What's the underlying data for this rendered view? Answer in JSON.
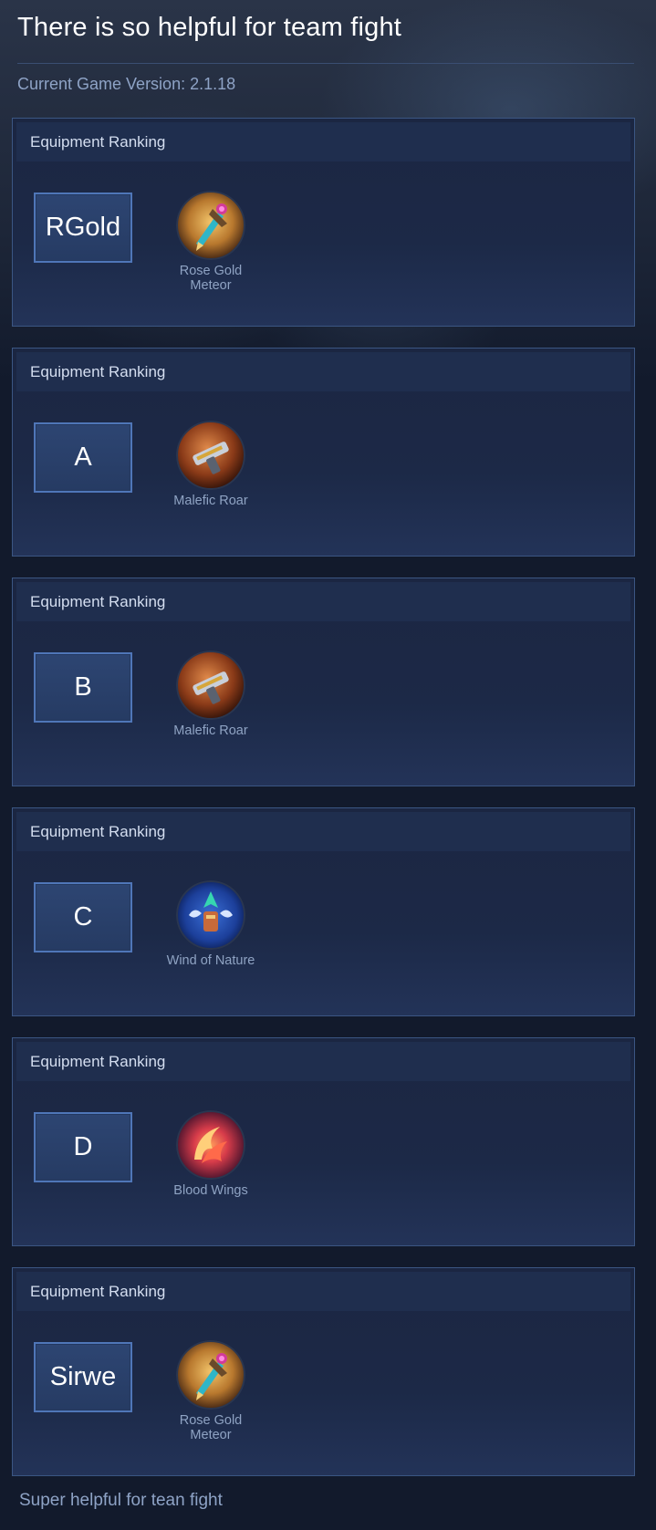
{
  "page": {
    "title": "There is so helpful for team fight",
    "version_text": "Current Game Version: 2.1.18",
    "footer_text": "Super helpful for tean fight"
  },
  "colors": {
    "background": "#121a2c",
    "card_border": "#3b5683",
    "badge_border": "#4f76b8",
    "muted_text": "#8ea3c6"
  },
  "rankings": [
    {
      "header": "Equipment Ranking",
      "tier": "RGold",
      "item": {
        "name": "Rose Gold Meteor",
        "icon": "rose-gold-meteor-icon"
      }
    },
    {
      "header": "Equipment Ranking",
      "tier": "A",
      "item": {
        "name": "Malefic Roar",
        "icon": "malefic-roar-icon"
      }
    },
    {
      "header": "Equipment Ranking",
      "tier": "B",
      "item": {
        "name": "Malefic Roar",
        "icon": "malefic-roar-icon"
      }
    },
    {
      "header": "Equipment Ranking",
      "tier": "C",
      "item": {
        "name": "Wind of Nature",
        "icon": "wind-of-nature-icon"
      }
    },
    {
      "header": "Equipment Ranking",
      "tier": "D",
      "item": {
        "name": "Blood Wings",
        "icon": "blood-wings-icon"
      }
    },
    {
      "header": "Equipment Ranking",
      "tier": "Sirwe",
      "item": {
        "name": "Rose Gold Meteor",
        "icon": "rose-gold-meteor-icon"
      }
    }
  ]
}
